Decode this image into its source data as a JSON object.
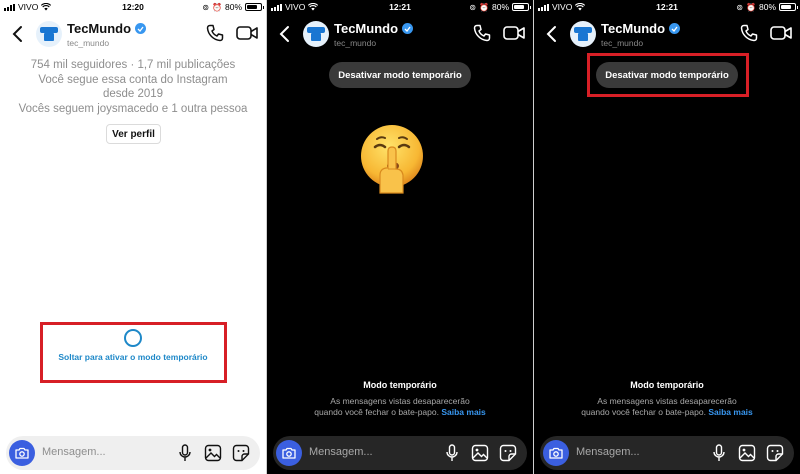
{
  "status": {
    "carrier": "VIVO",
    "battery": "80%",
    "battery_level": 0.8,
    "times": [
      "12:20",
      "12:21",
      "12:21"
    ]
  },
  "chat": {
    "name": "TecMundo",
    "username": "tec_mundo"
  },
  "profile": {
    "stats": "754 mil seguidores · 1,7 mil publicações",
    "follow_line1": "Você segue essa conta do Instagram",
    "follow_line2": "desde 2019",
    "mutual": "Vocês seguem joysmacedo e 1 outra pessoa",
    "view_profile": "Ver perfil"
  },
  "release_hint": "Soltar para ativar o modo temporário",
  "disable_label": "Desativar modo temporário",
  "vanish": {
    "title": "Modo temporário",
    "text_1": "As mensagens vistas desaparecerão",
    "text_2": "quando você fechar o bate-papo.",
    "link": "Saiba mais"
  },
  "composer": {
    "placeholder": "Mensagem..."
  },
  "icons": [
    "back-chevron-icon",
    "verified-badge-icon",
    "phone-icon",
    "video-camera-icon",
    "camera-icon",
    "microphone-icon",
    "gallery-icon",
    "sticker-icon",
    "shushing-face-emoji-icon"
  ],
  "colors": {
    "highlight_box": "#d71f26",
    "accent_blue": "#1e88c8",
    "link_blue": "#3897f0",
    "camera_button": "#3b5fe0",
    "dark_background": "#000000"
  }
}
